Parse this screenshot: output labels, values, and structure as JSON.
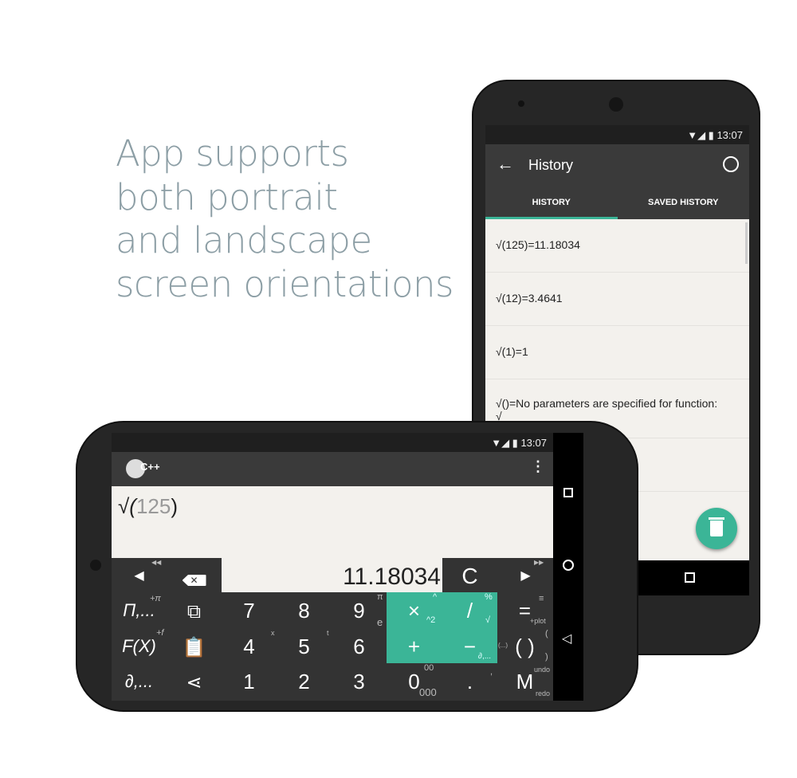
{
  "headline": [
    "App supports",
    "both portrait",
    "and landscape",
    "screen orientations"
  ],
  "colors": {
    "accent": "#3bb597",
    "headline": "#8c9ea5",
    "display_bg": "#f3f1ed"
  },
  "portrait": {
    "status_time": "13:07",
    "title": "History",
    "back_icon": "arrow-left-icon",
    "history_icon": "clock-icon",
    "tabs": [
      "HISTORY",
      "SAVED HISTORY"
    ],
    "active_tab": "HISTORY",
    "items": [
      "√(125)=11.18034",
      "√(12)=3.4641",
      "√(1)=1",
      "√()=No parameters are specified for function:",
      "√"
    ],
    "fab_icon": "trash-icon"
  },
  "landscape": {
    "status_time": "13:07",
    "logo": "C++",
    "expression_func": "√(",
    "expression_arg": "125",
    "expression_close": ")",
    "result": "11.18034",
    "clear": "C",
    "left_arrow": "◀",
    "right_arrow": "▶",
    "back_sub": "◀◀",
    "fwd_sub": "▶▶",
    "keys": {
      "r1": [
        "Π,...",
        "",
        "7",
        "8",
        "9",
        "×",
        "/",
        "="
      ],
      "r2": [
        "F(X)",
        "",
        "4",
        "5",
        "6",
        "+",
        "−",
        "( )"
      ],
      "r3": [
        "∂,...",
        "",
        "1",
        "2",
        "3",
        "0",
        ".",
        "M"
      ]
    },
    "subs": {
      "pi_plus": "+π",
      "f_plus": "+f",
      "pi": "π",
      "e": "e",
      "x": "x",
      "t": "t",
      "caret": "^",
      "sq": "^2",
      "pct": "%",
      "sqrt": "√",
      "plot": "+plot",
      "paren_open": "(",
      "paren_close": ")",
      "parens": "(...)",
      "deriv": "∂,...",
      "zz": "00",
      "zzz": "000",
      "comma": ",",
      "undo": "undo",
      "redo": "redo",
      "menu": "≡"
    }
  }
}
